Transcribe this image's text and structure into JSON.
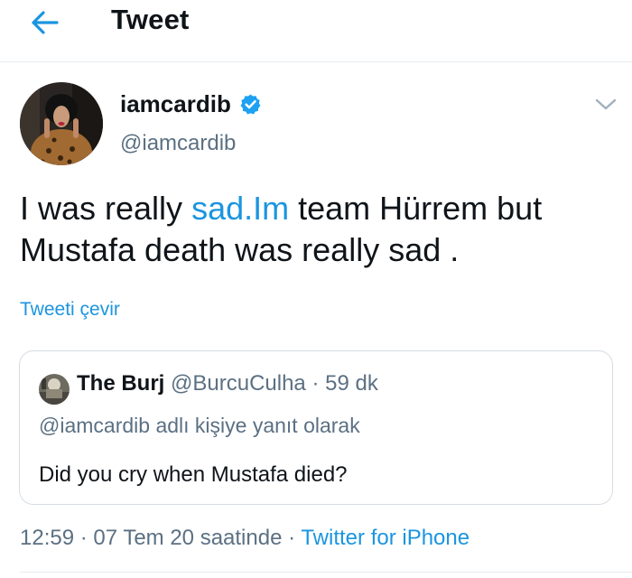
{
  "header": {
    "title": "Tweet",
    "back_icon": "arrow-left-icon"
  },
  "tweet": {
    "author": {
      "name": "iamcardib",
      "handle": "@iamcardib",
      "verified_icon": "verified-badge-icon"
    },
    "more_icon": "chevron-down-icon",
    "text": {
      "before": "I was really ",
      "link": "sad.Im",
      "after": " team Hürrem but Mustafa death was really sad ."
    },
    "translate_label": "Tweeti çevir",
    "quote": {
      "name": "The Burj",
      "handle": "@BurcuCulha",
      "separator": " · ",
      "time": "59 dk",
      "reply_context": "@iamcardib adlı kişiye yanıt olarak",
      "text": "Did you cry when Mustafa died?"
    },
    "meta": {
      "time": "12:59",
      "date": "07 Tem 20 saatinde",
      "separator": " · ",
      "source": "Twitter for iPhone"
    }
  },
  "colors": {
    "link": "#1b95e0",
    "secondary": "#5b7083",
    "border": "#e6ecf0",
    "text": "#0f1419"
  }
}
